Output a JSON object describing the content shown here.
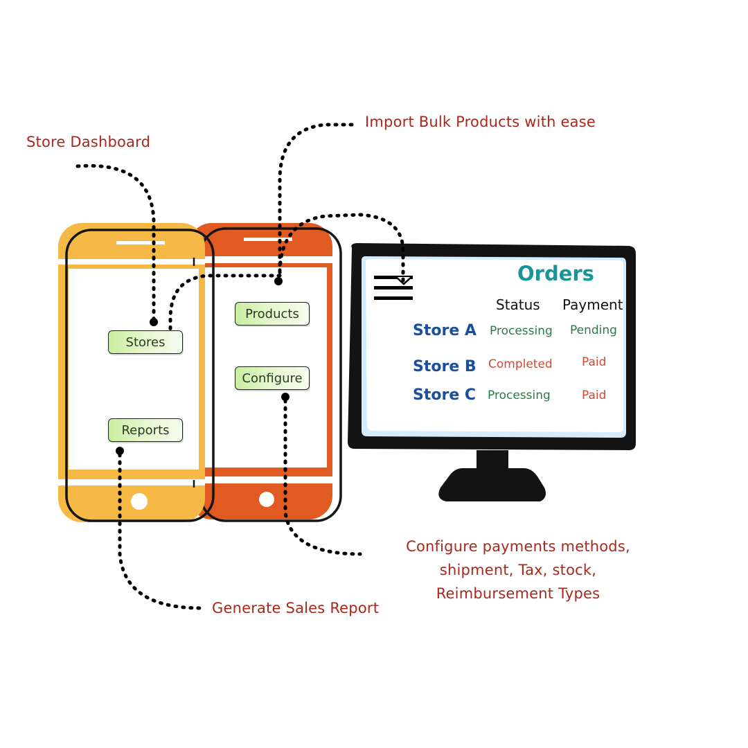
{
  "callouts": {
    "store_dashboard": "Store Dashboard",
    "import_bulk": "Import Bulk Products with ease",
    "configure_lines": [
      "Configure payments methods,",
      "shipment, Tax, stock,",
      "Reimbursement Types"
    ],
    "generate_report": "Generate Sales Report"
  },
  "phone_left": {
    "color": "#f7b946",
    "buttons": [
      {
        "label": "Stores"
      },
      {
        "label": "Reports"
      }
    ]
  },
  "phone_right": {
    "color": "#e05a22",
    "buttons": [
      {
        "label": "Products"
      },
      {
        "label": "Configure"
      }
    ]
  },
  "monitor": {
    "title": "Orders",
    "menu_icon": "hamburger-menu-icon",
    "columns": [
      "Status",
      "Payment"
    ],
    "rows": [
      {
        "store": "Store A",
        "status": "Processing",
        "status_color": "#2a7a45",
        "payment": "Pending",
        "payment_color": "#2a7a45"
      },
      {
        "store": "Store B",
        "status": "Completed",
        "status_color": "#cf4a36",
        "payment": "Paid",
        "payment_color": "#cf4a36"
      },
      {
        "store": "Store C",
        "status": "Processing",
        "status_color": "#2a7a45",
        "payment": "Paid",
        "payment_color": "#cf4a36"
      }
    ]
  },
  "colors": {
    "callout_text": "#a8281b",
    "orders_title": "#17969a",
    "store_name": "#1a4f9c",
    "status_green": "#2a7a45",
    "status_red": "#cf4a36",
    "button_green": "#c9eda0",
    "screen_tint": "#d6ebfb"
  }
}
